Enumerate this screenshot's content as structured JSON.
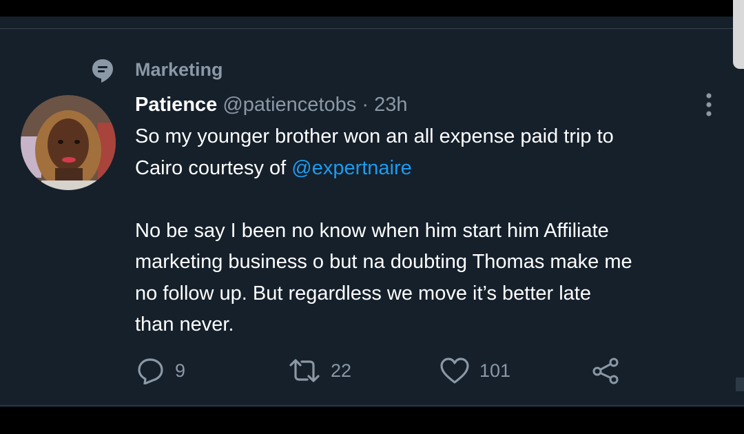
{
  "topic": {
    "label": "Marketing",
    "icon": "topic-icon"
  },
  "tweet": {
    "display_name": "Patience",
    "handle": "@patiencetobs",
    "separator": "·",
    "time": "23h",
    "line1": "So my younger brother won an all expense paid trip to",
    "line2_prefix": "Cairo courtesy of ",
    "mention": "@expertnaire",
    "paragraph2_line1": "No be say I been no know when him start him Affiliate",
    "paragraph2_line2": "marketing business o but na doubting Thomas make me",
    "paragraph2_line3": "no follow up. But regardless we move it’s better late",
    "paragraph2_line4": "than never."
  },
  "actions": {
    "replies": "9",
    "retweets": "22",
    "likes": "101",
    "icons": [
      "reply-icon",
      "retweet-icon",
      "like-icon",
      "share-icon"
    ]
  },
  "colors": {
    "background": "#15202b",
    "secondary_text": "#8b98a5",
    "link": "#1d9bf0",
    "divider": "#38444d"
  }
}
